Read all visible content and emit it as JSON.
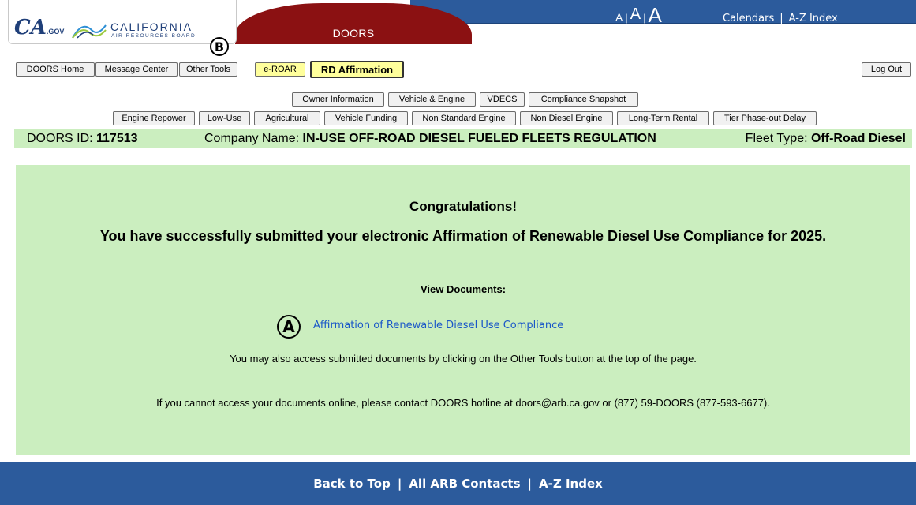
{
  "header": {
    "logo_ca": "CA",
    "logo_gov": ".GOV",
    "logo_california": "CALIFORNIA",
    "logo_arb": "AIR RESOURCES BOARD",
    "section_tab": "DOORS",
    "font_sizes": [
      "A",
      "A",
      "A"
    ],
    "font_sep": "|",
    "links": [
      "Calendars",
      "A-Z Index"
    ],
    "link_sep": "|",
    "colors": {
      "blue_band": "#2c5b9c",
      "dark_tab": "#8b1112"
    }
  },
  "annotations": {
    "marker_a": "A",
    "marker_b": "B"
  },
  "toolbar": {
    "doors_home": "DOORS Home",
    "message_center": "Message Center",
    "other_tools": "Other Tools",
    "e_roar": "e-ROAR",
    "rd_affirmation": "RD Affirmation",
    "log_out": "Log Out"
  },
  "nav_row1": [
    "Owner Information",
    "Vehicle & Engine",
    "VDECS",
    "Compliance Snapshot"
  ],
  "nav_row2": [
    "Engine Repower",
    "Low-Use",
    "Agricultural",
    "Vehicle Funding",
    "Non Standard Engine",
    "Non Diesel Engine",
    "Long-Term Rental",
    "Tier Phase-out Delay"
  ],
  "info": {
    "doors_id_label": "DOORS ID: ",
    "doors_id": "117513",
    "company_label": "Company Name: ",
    "company": "IN-USE OFF-ROAD DIESEL FUELED FLEETS REGULATION",
    "fleet_label": "Fleet Type: ",
    "fleet": "Off-Road Diesel"
  },
  "main": {
    "congrats": "Congratulations!",
    "success": "You have successfully submitted your electronic Affirmation of Renewable Diesel Use Compliance for 2025.",
    "view_docs": "View Documents:",
    "doc_link": "Affirmation of Renewable Diesel Use Compliance",
    "also_access": "You may also access submitted documents by clicking on the Other Tools button at the top of the page.",
    "contact": "If you cannot access your documents online, please contact DOORS hotline at doors@arb.ca.gov or (877) 59-DOORS (877-593-6677)."
  },
  "footer": {
    "links": [
      "Back to Top",
      "All ARB Contacts",
      "A-Z Index"
    ],
    "sep": "|"
  }
}
